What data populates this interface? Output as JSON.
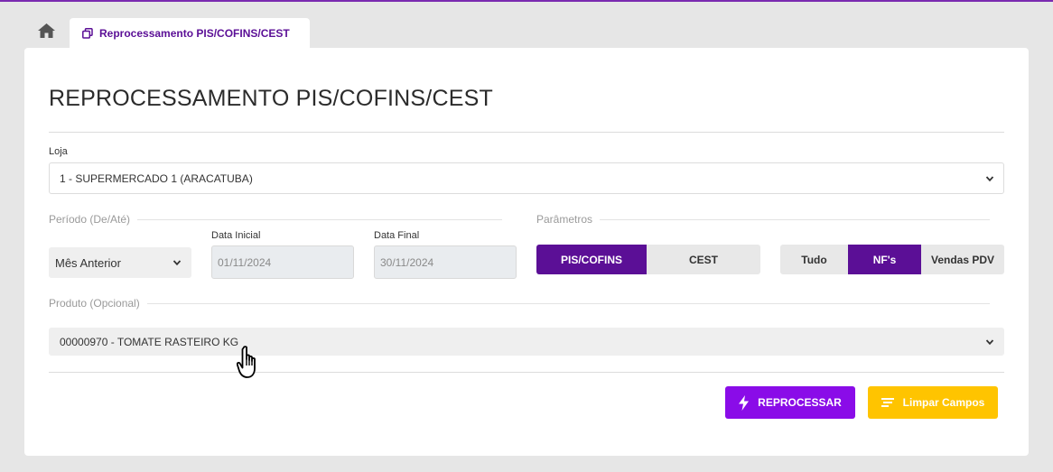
{
  "tabs": {
    "home_icon": "home-icon",
    "active_label": "Reprocessamento PIS/COFINS/CEST",
    "active_icon": "copy-icon"
  },
  "page": {
    "title": "REPROCESSAMENTO PIS/COFINS/CEST"
  },
  "loja": {
    "label": "Loja",
    "value": "1 - SUPERMERCADO 1 (ARACATUBA)"
  },
  "periodo": {
    "legend": "Período (De/Até)",
    "selected": "Mês Anterior",
    "data_inicial_label": "Data Inicial",
    "data_inicial_value": "01/11/2024",
    "data_final_label": "Data Final",
    "data_final_value": "30/11/2024"
  },
  "parametros": {
    "legend": "Parâmetros",
    "group1": [
      {
        "label": "PIS/COFINS",
        "active": true
      },
      {
        "label": "CEST",
        "active": false
      }
    ],
    "group2": [
      {
        "label": "Tudo",
        "active": false
      },
      {
        "label": "NF's",
        "active": true
      },
      {
        "label": "Vendas PDV",
        "active": false
      }
    ]
  },
  "produto": {
    "legend": "Produto (Opcional)",
    "value": "00000970 - TOMATE RASTEIRO KG"
  },
  "actions": {
    "reprocessar_label": "REPROCESSAR",
    "reprocessar_icon": "bolt-icon",
    "limpar_label": "Limpar Campos",
    "limpar_icon": "clear-lines-icon"
  },
  "colors": {
    "primary_purple": "#5b0f96",
    "button_purple": "#8a0ce8",
    "button_yellow": "#ffc400"
  }
}
